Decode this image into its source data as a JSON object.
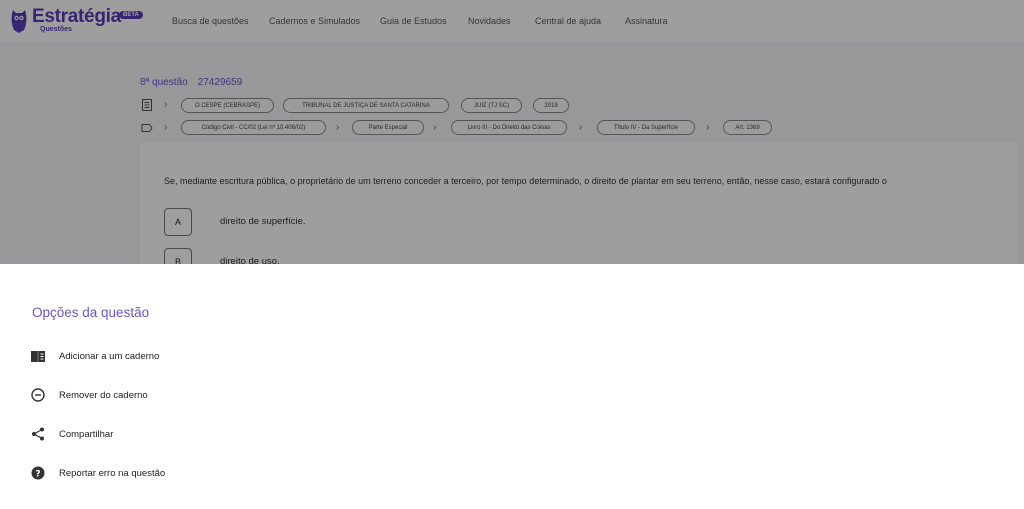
{
  "header": {
    "logo_name": "Estratégia",
    "logo_sub": "Questões",
    "beta": "BETA",
    "nav": [
      "Busca de questões",
      "Cadernos e Simulados",
      "Guia de Estudos",
      "Novidades",
      "Central de ajuda",
      "Assinatura"
    ]
  },
  "question": {
    "number": "8ª questão",
    "id": "27429659",
    "meta_chips": [
      "O CESPE (CEBRASPE)",
      "TRIBUNAL DE JUSTIÇA DE SANTA CATARINA",
      "JUIZ (TJ SC)",
      "2019"
    ],
    "subject_chips": [
      "Código Civil - CC/02 (Lei nº 10.406/02)",
      "Parte Especial",
      "Livro III - Do Direito das Coisas",
      "Título IV - Da Superfície",
      "Art. 1369"
    ],
    "text": "Se, mediante escritura pública, o proprietário de um terreno conceder a terceiro, por tempo determinado, o direito de plantar em seu terreno, então, nesse caso, estará configurado o",
    "options": [
      {
        "letter": "A",
        "text": "direito de superfície."
      },
      {
        "letter": "B",
        "text": "direito de uso."
      }
    ]
  },
  "sheet": {
    "title": "Opções da questão",
    "items": [
      {
        "label": "Adicionar a um caderno",
        "icon": "book-icon"
      },
      {
        "label": "Remover do caderno",
        "icon": "minus-circle-icon"
      },
      {
        "label": "Compartilhar",
        "icon": "share-icon"
      },
      {
        "label": "Reportar erro na questão",
        "icon": "help-circle-icon"
      }
    ]
  },
  "colors": {
    "brand": "#5a3db8",
    "accent": "#6c55c9"
  }
}
